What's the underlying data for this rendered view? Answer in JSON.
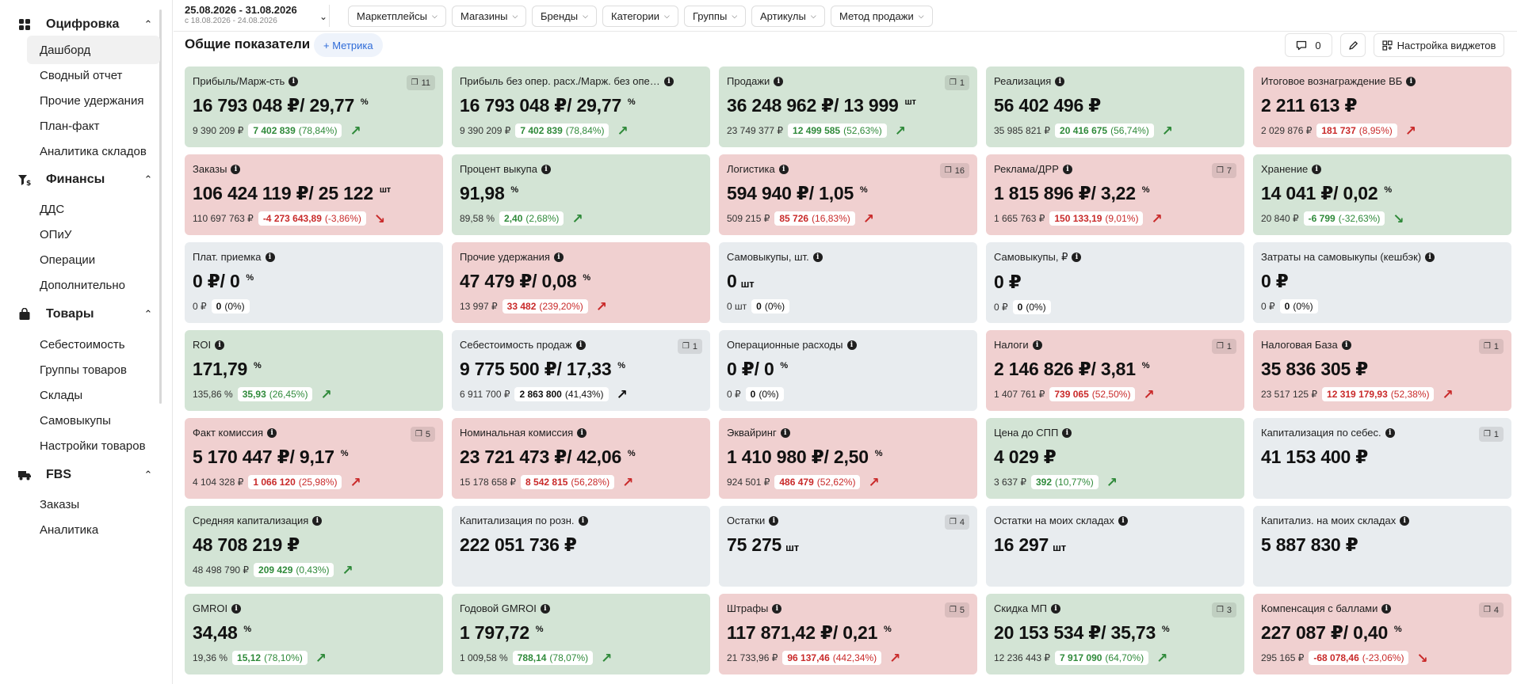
{
  "sidebar": {
    "sections": [
      {
        "label": "Оцифровка",
        "icon": "grid-icon",
        "items": [
          "Дашборд",
          "Сводный отчет",
          "Прочие удержания",
          "План-факт",
          "Аналитика складов"
        ]
      },
      {
        "label": "Финансы",
        "icon": "finance-icon",
        "items": [
          "ДДС",
          "ОПиУ",
          "Операции",
          "Дополнительно"
        ]
      },
      {
        "label": "Товары",
        "icon": "bag-icon",
        "items": [
          "Себестоимость",
          "Группы товаров",
          "Склады",
          "Самовыкупы",
          "Настройки товаров"
        ]
      },
      {
        "label": "FBS",
        "icon": "truck-icon",
        "items": [
          "Заказы",
          "Аналитика"
        ]
      }
    ]
  },
  "topbar": {
    "date_range": "25.08.2026 - 31.08.2026",
    "date_compare": "с 18.08.2026 - 24.08.2026",
    "filters": [
      "Маркетплейсы",
      "Магазины",
      "Бренды",
      "Категории",
      "Группы",
      "Артикулы",
      "Метод продажи"
    ]
  },
  "header": {
    "title": "Общие показатели",
    "add_metric": "+ Метрика",
    "comments_count": "0",
    "settings_label": "Настройка виджетов"
  },
  "cards": [
    {
      "title": "Прибыль/Марж-сть",
      "badge": "11",
      "value": "16 793 048 ₽/ 29,77",
      "sup": "%",
      "prev": "9 390 209 ₽",
      "delta": "7 402 839",
      "pct": "(78,84%)",
      "trend": "up",
      "color": "green"
    },
    {
      "title": "Прибыль без опер. расх./Марж. без опер. ра...",
      "badge": "",
      "value": "16 793 048 ₽/ 29,77",
      "sup": "%",
      "prev": "9 390 209 ₽",
      "delta": "7 402 839",
      "pct": "(78,84%)",
      "trend": "up",
      "color": "green"
    },
    {
      "title": "Продажи",
      "badge": "1",
      "value": "36 248 962 ₽/ 13 999",
      "sup": "шт",
      "prev": "23 749 377 ₽",
      "delta": "12 499 585",
      "pct": "(52,63%)",
      "trend": "up",
      "color": "green"
    },
    {
      "title": "Реализация",
      "badge": "",
      "value": "56 402 496 ₽",
      "sup": "",
      "prev": "35 985 821 ₽",
      "delta": "20 416 675",
      "pct": "(56,74%)",
      "trend": "up",
      "color": "green"
    },
    {
      "title": "Итоговое вознаграждение ВБ",
      "badge": "",
      "value": "2 211 613 ₽",
      "sup": "",
      "prev": "2 029 876 ₽",
      "delta": "181 737",
      "pct": "(8,95%)",
      "trend": "up-bad",
      "color": "red"
    },
    {
      "title": "Заказы",
      "badge": "",
      "value": "106 424 119 ₽/ 25 122",
      "sup": "шт",
      "prev": "110 697 763 ₽",
      "delta": "-4 273 643,89",
      "pct": "(-3,86%)",
      "trend": "down-bad",
      "color": "red"
    },
    {
      "title": "Процент выкупа",
      "badge": "",
      "value": "91,98",
      "sup": "%",
      "prev": "89,58 %",
      "delta": "2,40",
      "pct": "(2,68%)",
      "trend": "up",
      "color": "green"
    },
    {
      "title": "Логистика",
      "badge": "16",
      "value": "594 940 ₽/ 1,05",
      "sup": "%",
      "prev": "509 215 ₽",
      "delta": "85 726",
      "pct": "(16,83%)",
      "trend": "up-bad",
      "color": "red"
    },
    {
      "title": "Реклама/ДРР",
      "badge": "7",
      "value": "1 815 896 ₽/ 3,22",
      "sup": "%",
      "prev": "1 665 763 ₽",
      "delta": "150 133,19",
      "pct": "(9,01%)",
      "trend": "up-bad",
      "color": "red"
    },
    {
      "title": "Хранение",
      "badge": "",
      "value": "14 041 ₽/ 0,02",
      "sup": "%",
      "prev": "20 840 ₽",
      "delta": "-6 799",
      "pct": "(-32,63%)",
      "trend": "down-good",
      "color": "green"
    },
    {
      "title": "Плат. приемка",
      "badge": "",
      "value": "0 ₽/ 0",
      "sup": "%",
      "prev": "0 ₽",
      "delta": "0",
      "pct": "(0%)",
      "trend": "none",
      "color": "gray"
    },
    {
      "title": "Прочие удержания",
      "badge": "",
      "value": "47 479 ₽/ 0,08",
      "sup": "%",
      "prev": "13 997 ₽",
      "delta": "33 482",
      "pct": "(239,20%)",
      "trend": "up-bad",
      "color": "red"
    },
    {
      "title": "Самовыкупы, шт.",
      "badge": "",
      "value": "0",
      "sup": "",
      "unit": "шт",
      "prev": "0 шт",
      "delta": "0",
      "pct": "(0%)",
      "trend": "none",
      "color": "gray"
    },
    {
      "title": "Самовыкупы, ₽",
      "badge": "",
      "value": "0 ₽",
      "sup": "",
      "prev": "0 ₽",
      "delta": "0",
      "pct": "(0%)",
      "trend": "none",
      "color": "gray"
    },
    {
      "title": "Затраты на самовыкупы (кешбэк)",
      "badge": "",
      "value": "0 ₽",
      "sup": "",
      "prev": "0 ₽",
      "delta": "0",
      "pct": "(0%)",
      "trend": "none",
      "color": "gray"
    },
    {
      "title": "ROI",
      "badge": "",
      "value": "171,79",
      "sup": "%",
      "prev": "135,86 %",
      "delta": "35,93",
      "pct": "(26,45%)",
      "trend": "up",
      "color": "green"
    },
    {
      "title": "Себестоимость продаж",
      "badge": "1",
      "value": "9 775 500 ₽/ 17,33",
      "sup": "%",
      "prev": "6 911 700 ₽",
      "delta": "2 863 800",
      "pct": "(41,43%)",
      "trend": "up-neutral",
      "color": "gray"
    },
    {
      "title": "Операционные расходы",
      "badge": "",
      "value": "0 ₽/ 0",
      "sup": "%",
      "prev": "0 ₽",
      "delta": "0",
      "pct": "(0%)",
      "trend": "none",
      "color": "gray"
    },
    {
      "title": "Налоги",
      "badge": "1",
      "value": "2 146 826 ₽/ 3,81",
      "sup": "%",
      "prev": "1 407 761 ₽",
      "delta": "739 065",
      "pct": "(52,50%)",
      "trend": "up-bad",
      "color": "red"
    },
    {
      "title": "Налоговая База",
      "badge": "1",
      "value": "35 836 305 ₽",
      "sup": "",
      "prev": "23 517 125 ₽",
      "delta": "12 319 179,93",
      "pct": "(52,38%)",
      "trend": "up-bad",
      "color": "red"
    },
    {
      "title": "Факт комиссия",
      "badge": "5",
      "value": "5 170 447 ₽/ 9,17",
      "sup": "%",
      "prev": "4 104 328 ₽",
      "delta": "1 066 120",
      "pct": "(25,98%)",
      "trend": "up-bad",
      "color": "red"
    },
    {
      "title": "Номинальная комиссия",
      "badge": "",
      "value": "23 721 473 ₽/ 42,06",
      "sup": "%",
      "prev": "15 178 658 ₽",
      "delta": "8 542 815",
      "pct": "(56,28%)",
      "trend": "up-bad",
      "color": "red"
    },
    {
      "title": "Эквайринг",
      "badge": "",
      "value": "1 410 980 ₽/ 2,50",
      "sup": "%",
      "prev": "924 501 ₽",
      "delta": "486 479",
      "pct": "(52,62%)",
      "trend": "up-bad",
      "color": "red"
    },
    {
      "title": "Цена до СПП",
      "badge": "",
      "value": "4 029 ₽",
      "sup": "",
      "prev": "3 637 ₽",
      "delta": "392",
      "pct": "(10,77%)",
      "trend": "up",
      "color": "green"
    },
    {
      "title": "Капитализация по себес.",
      "badge": "1",
      "value": "41 153 400 ₽",
      "sup": "",
      "prev": "",
      "delta": "",
      "pct": "",
      "trend": "hidden",
      "color": "gray"
    },
    {
      "title": "Средняя капитализация",
      "badge": "",
      "value": "48 708 219 ₽",
      "sup": "",
      "prev": "48 498 790 ₽",
      "delta": "209 429",
      "pct": "(0,43%)",
      "trend": "up",
      "color": "green"
    },
    {
      "title": "Капитализация по розн.",
      "badge": "",
      "value": "222 051 736 ₽",
      "sup": "",
      "prev": "",
      "delta": "",
      "pct": "",
      "trend": "hidden",
      "color": "gray"
    },
    {
      "title": "Остатки",
      "badge": "4",
      "value": "75 275",
      "sup": "",
      "unit": "шт",
      "prev": "",
      "delta": "",
      "pct": "",
      "trend": "hidden",
      "color": "gray"
    },
    {
      "title": "Остатки на моих складах",
      "badge": "",
      "value": "16 297",
      "sup": "",
      "unit": "шт",
      "prev": "",
      "delta": "",
      "pct": "",
      "trend": "hidden",
      "color": "gray"
    },
    {
      "title": "Капитализ. на моих складах",
      "badge": "",
      "value": "5 887 830 ₽",
      "sup": "",
      "prev": "",
      "delta": "",
      "pct": "",
      "trend": "hidden",
      "color": "gray"
    },
    {
      "title": "GMROI",
      "badge": "",
      "value": "34,48",
      "sup": "%",
      "prev": "19,36 %",
      "delta": "15,12",
      "pct": "(78,10%)",
      "trend": "up",
      "color": "green"
    },
    {
      "title": "Годовой GMROI",
      "badge": "",
      "value": "1 797,72",
      "sup": "%",
      "prev": "1 009,58 %",
      "delta": "788,14",
      "pct": "(78,07%)",
      "trend": "up",
      "color": "green"
    },
    {
      "title": "Штрафы",
      "badge": "5",
      "value": "117 871,42 ₽/ 0,21",
      "sup": "%",
      "prev": "21 733,96 ₽",
      "delta": "96 137,46",
      "pct": "(442,34%)",
      "trend": "up-bad",
      "color": "red"
    },
    {
      "title": "Скидка МП",
      "badge": "3",
      "value": "20 153 534 ₽/ 35,73",
      "sup": "%",
      "prev": "12 236 443 ₽",
      "delta": "7 917 090",
      "pct": "(64,70%)",
      "trend": "up",
      "color": "green"
    },
    {
      "title": "Компенсация с баллами",
      "badge": "4",
      "value": "227 087 ₽/ 0,40",
      "sup": "%",
      "prev": "295 165 ₽",
      "delta": "-68 078,46",
      "pct": "(-23,06%)",
      "trend": "down-bad",
      "color": "red"
    }
  ]
}
